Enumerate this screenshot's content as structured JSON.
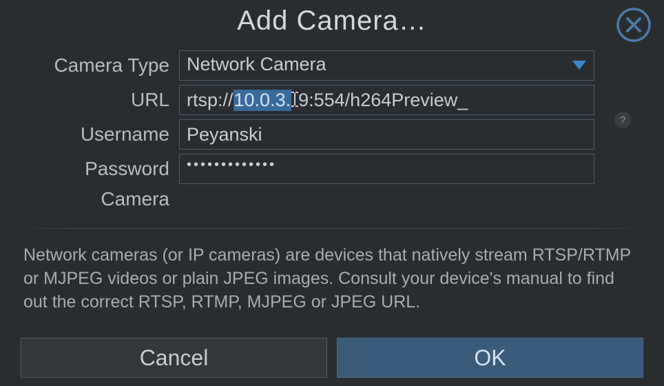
{
  "dialog": {
    "title": "Add Camera…"
  },
  "form": {
    "camera_type_label": "Camera Type",
    "camera_type_value": "Network Camera",
    "url_label": "URL",
    "url_prefix": "rtsp://",
    "url_selected": "10.0.3.",
    "url_cursor_char": "9",
    "url_suffix": ":554/h264Preview_",
    "url_full": "rtsp://10.0.3.19:554/h264Preview_",
    "username_label": "Username",
    "username_value": "Peyanski",
    "password_label": "Password",
    "password_value": "•••••••••••••",
    "camera_label": "Camera"
  },
  "help": {
    "text": "Network cameras (or IP cameras) are devices that natively stream RTSP/RTMP or MJPEG videos or plain JPEG images. Consult your device's manual to find out the correct RTSP, RTMP, MJPEG or JPEG URL.",
    "tooltip_symbol": "?"
  },
  "buttons": {
    "cancel": "Cancel",
    "ok": "OK"
  },
  "colors": {
    "accent": "#3a6ea0",
    "background": "#2a2d30",
    "border": "#4a5b6a",
    "text": "#b8bcc0"
  }
}
